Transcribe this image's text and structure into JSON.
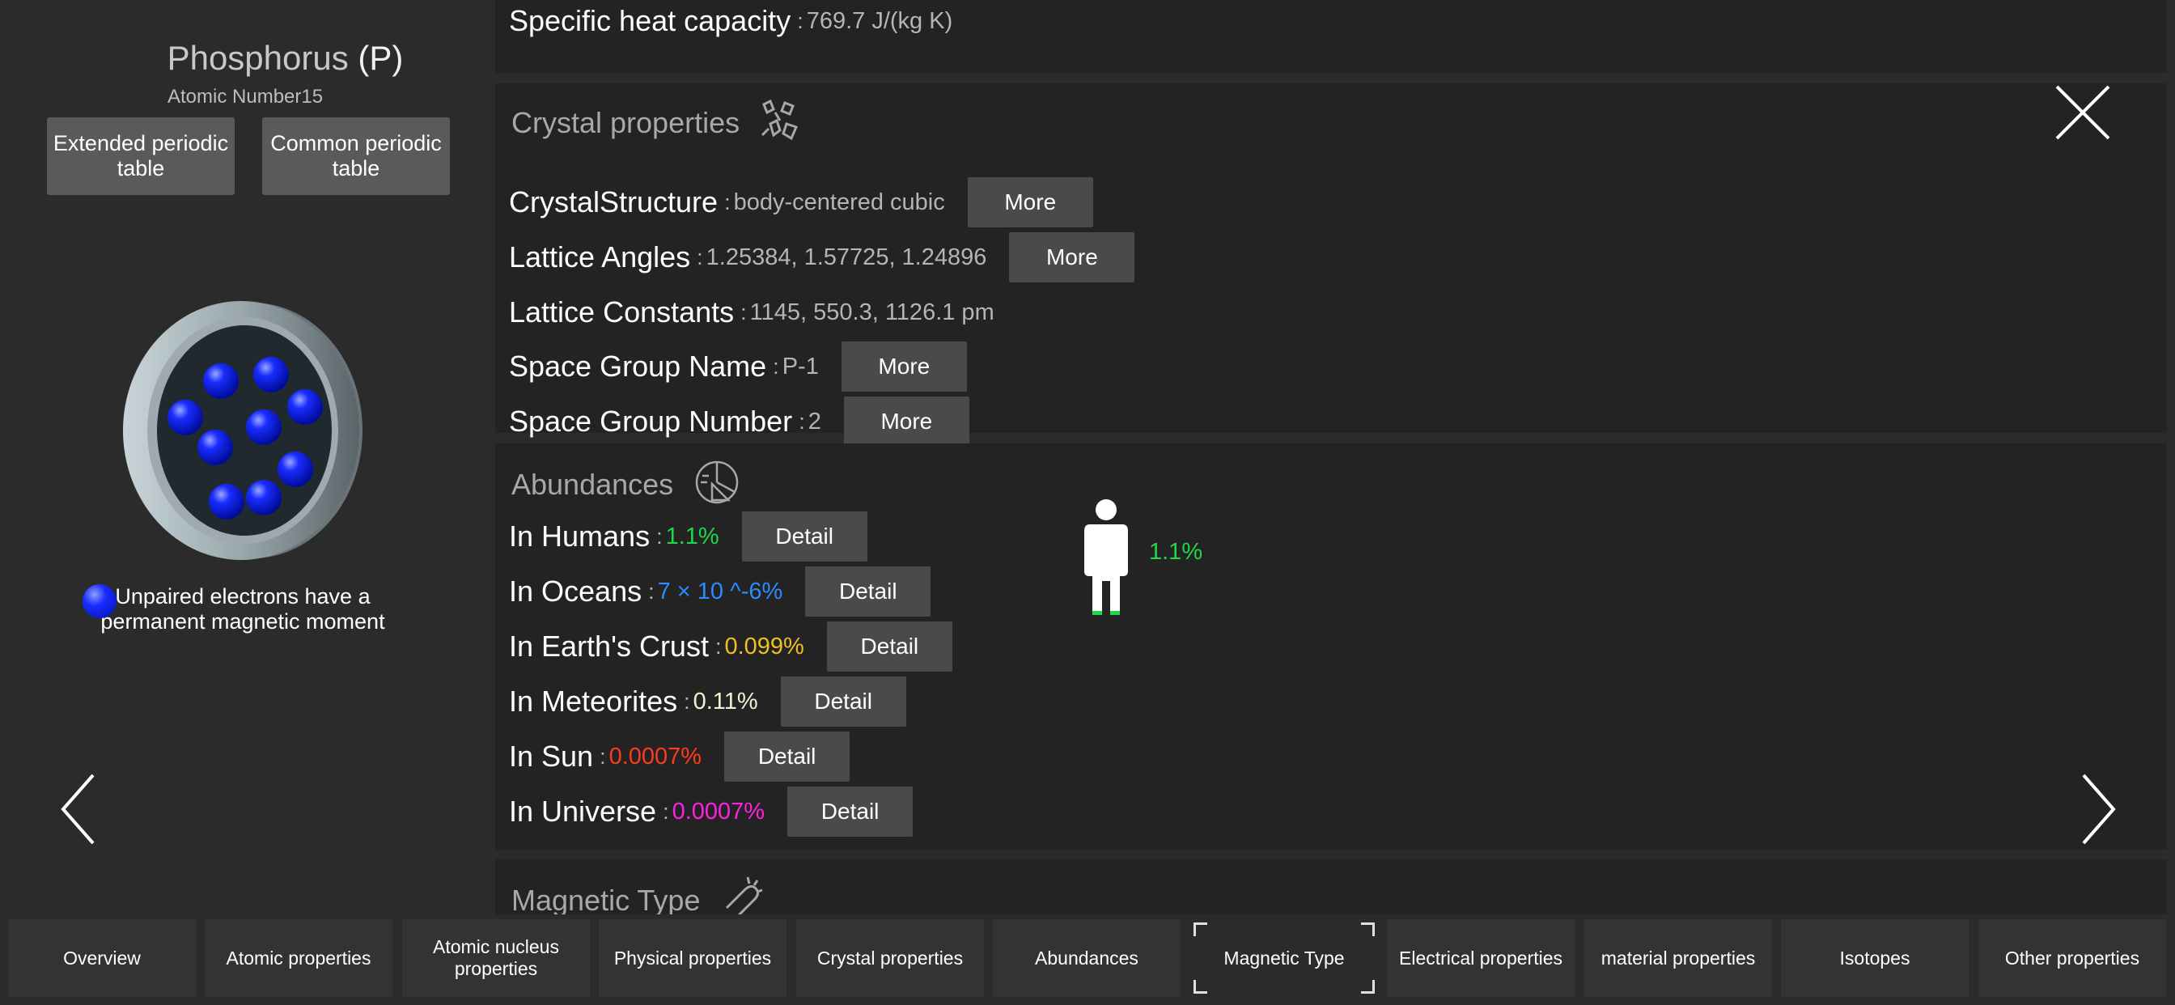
{
  "element": {
    "name": "Phosphorus",
    "symbol": "(P)",
    "atomic_number_label": "Atomic Number",
    "atomic_number": "15"
  },
  "left_buttons": {
    "extended": "Extended periodic table",
    "common": "Common periodic table"
  },
  "legend_text": "Unpaired electrons have a permanent magnetic moment",
  "top_row": {
    "label": "Specific heat capacity",
    "sep": ":",
    "value": "769.7 J/(kg K)"
  },
  "crystal": {
    "title": "Crystal properties",
    "icon": "crystal-icon",
    "rows": [
      {
        "label": "CrystalStructure",
        "sep": ":",
        "value": "body-centered cubic",
        "button": "More"
      },
      {
        "label": "Lattice Angles",
        "sep": ":",
        "value": "1.25384, 1.57725, 1.24896",
        "button": "More"
      },
      {
        "label": "Lattice Constants",
        "sep": ":",
        "value": "1145, 550.3, 1126.1 pm",
        "button": ""
      },
      {
        "label": "Space Group Name",
        "sep": ":",
        "value": "P-1",
        "button": "More"
      },
      {
        "label": "Space Group Number",
        "sep": ":",
        "value": "2",
        "button": "More"
      }
    ]
  },
  "abundances": {
    "title": "Abundances",
    "icon": "pie-chart-icon",
    "rows": [
      {
        "label": "In Humans",
        "sep": ":",
        "value": "1.1%",
        "color": "#1ed84a",
        "button": "Detail"
      },
      {
        "label": "In Oceans",
        "sep": ":",
        "value": "7 × 10 ^-6%",
        "color": "#2a8cff",
        "button": "Detail"
      },
      {
        "label": "In Earth's Crust",
        "sep": ":",
        "value": "0.099%",
        "color": "#f0c020",
        "button": "Detail"
      },
      {
        "label": "In Meteorites",
        "sep": ":",
        "value": "0.11%",
        "color": "#f2f2d0",
        "button": "Detail"
      },
      {
        "label": "In Sun",
        "sep": ":",
        "value": "0.0007%",
        "color": "#ff3a1a",
        "button": "Detail"
      },
      {
        "label": "In Universe",
        "sep": ":",
        "value": "0.0007%",
        "color": "#ff20e0",
        "button": "Detail"
      }
    ],
    "human_value": "1.1%"
  },
  "magnetic": {
    "title": "Magnetic Type",
    "icon": "magnet-icon"
  },
  "tabs": [
    "Overview",
    "Atomic properties",
    "Atomic nucleus properties",
    "Physical properties",
    "Crystal properties",
    "Abundances",
    "Magnetic Type",
    "Electrical properties",
    "material properties",
    "Isotopes",
    "Other properties"
  ],
  "active_tab": "Magnetic Type"
}
